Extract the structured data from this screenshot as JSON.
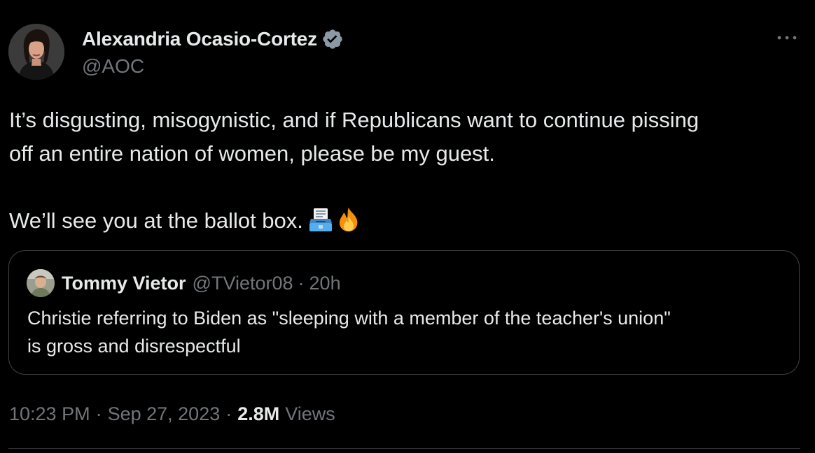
{
  "author": {
    "name": "Alexandria Ocasio-Cortez",
    "handle": "@AOC",
    "verified": true,
    "verified_color": "#8b98a5",
    "avatar_icon": "avatar-photo"
  },
  "more_icon": "more-horizontal-icon",
  "tweet": {
    "lines": [
      "It’s disgusting, misogynistic, and if Republicans want to continue pissing",
      "off an entire nation of women, please be my guest.",
      "",
      "We’ll see you at the ballot box."
    ],
    "emojis": [
      "ballot-box-icon",
      "fire-icon"
    ]
  },
  "quote": {
    "name": "Tommy Vietor",
    "handle": "@TVietor08",
    "separator": "·",
    "time": "20h",
    "lines": [
      "Christie referring to Biden as \"sleeping with a member of the teacher's union\"",
      "is gross and disrespectful"
    ]
  },
  "meta": {
    "time": "10:23 PM",
    "separator": "·",
    "date": "Sep 27, 2023",
    "views_count": "2.8M",
    "views_label": "Views"
  },
  "colors": {
    "background": "#000000",
    "text_primary": "#e7e9ea",
    "text_secondary": "#71767b",
    "border": "#3e4144"
  }
}
